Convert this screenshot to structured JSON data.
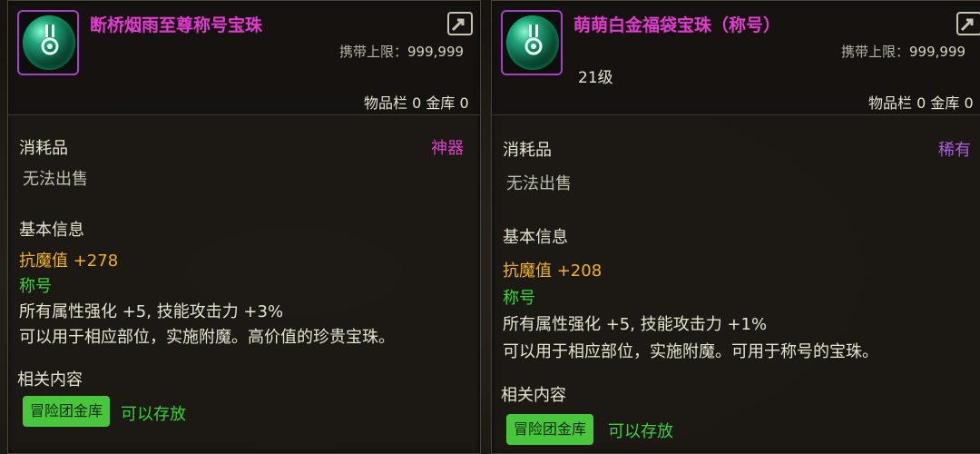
{
  "colors": {
    "title_magenta": "#e43ad2",
    "rarity_artifact": "#e43ad2",
    "rarity_rare": "#b15ce0",
    "stat_yellow": "#f2b31f",
    "label_green": "#36d43a",
    "badge_green": "#48c73c",
    "icon_border": "#a640c8"
  },
  "cards": [
    {
      "title": "断桥烟雨至尊称号宝珠",
      "icon": "bead-orb-icon",
      "carry_label": "携带上限：",
      "carry_value": "999,999",
      "level": "",
      "inventory": "物品栏 0  金库 0",
      "category": "消耗品",
      "rarity": "神器",
      "sell": "无法出售",
      "basic_info": "基本信息",
      "stat": "抗魔值 +278",
      "title_label": "称号",
      "effect": "所有属性强化 +5, 技能攻击力 +3%",
      "desc": "可以用于相应部位，实施附魔。高价值的珍贵宝珠。",
      "related": "相关内容",
      "badge": "冒险团金库",
      "store_text": "可以存放"
    },
    {
      "title": "萌萌白金福袋宝珠（称号）",
      "icon": "bead-orb-icon",
      "carry_label": "携带上限：",
      "carry_value": "999,999",
      "level": "21级",
      "inventory": "物品栏 0  金库 0",
      "category": "消耗品",
      "rarity": "稀有",
      "sell": "无法出售",
      "basic_info": "基本信息",
      "stat": "抗魔值 +208",
      "title_label": "称号",
      "effect": "所有属性强化 +5, 技能攻击力 +1%",
      "desc": "可以用于相应部位，实施附魔。可用于称号的宝珠。",
      "related": "相关内容",
      "badge": "冒险团金库",
      "store_text": "可以存放"
    }
  ]
}
